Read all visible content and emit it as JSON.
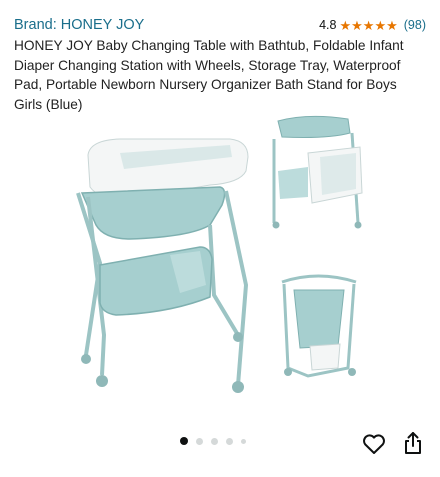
{
  "brand": "Brand: HONEY JOY",
  "rating": {
    "value": "4.8",
    "stars": "★★★★★",
    "count": "(98)"
  },
  "title": "HONEY JOY Baby Changing Table with Bathtub, Foldable Infant Diaper Changing Station with Wheels, Storage Tray, Waterproof Pad, Portable Newborn Nursery Organizer Bath Stand for Boys Girls (Blue)",
  "gallery": {
    "total": 5,
    "active_index": 1
  },
  "icons": {
    "favorite": "heart-outline-icon",
    "share": "share-icon"
  },
  "colors": {
    "brand_link": "#1a6e8b",
    "star": "#e77600",
    "product_teal": "#a6cfcf"
  }
}
